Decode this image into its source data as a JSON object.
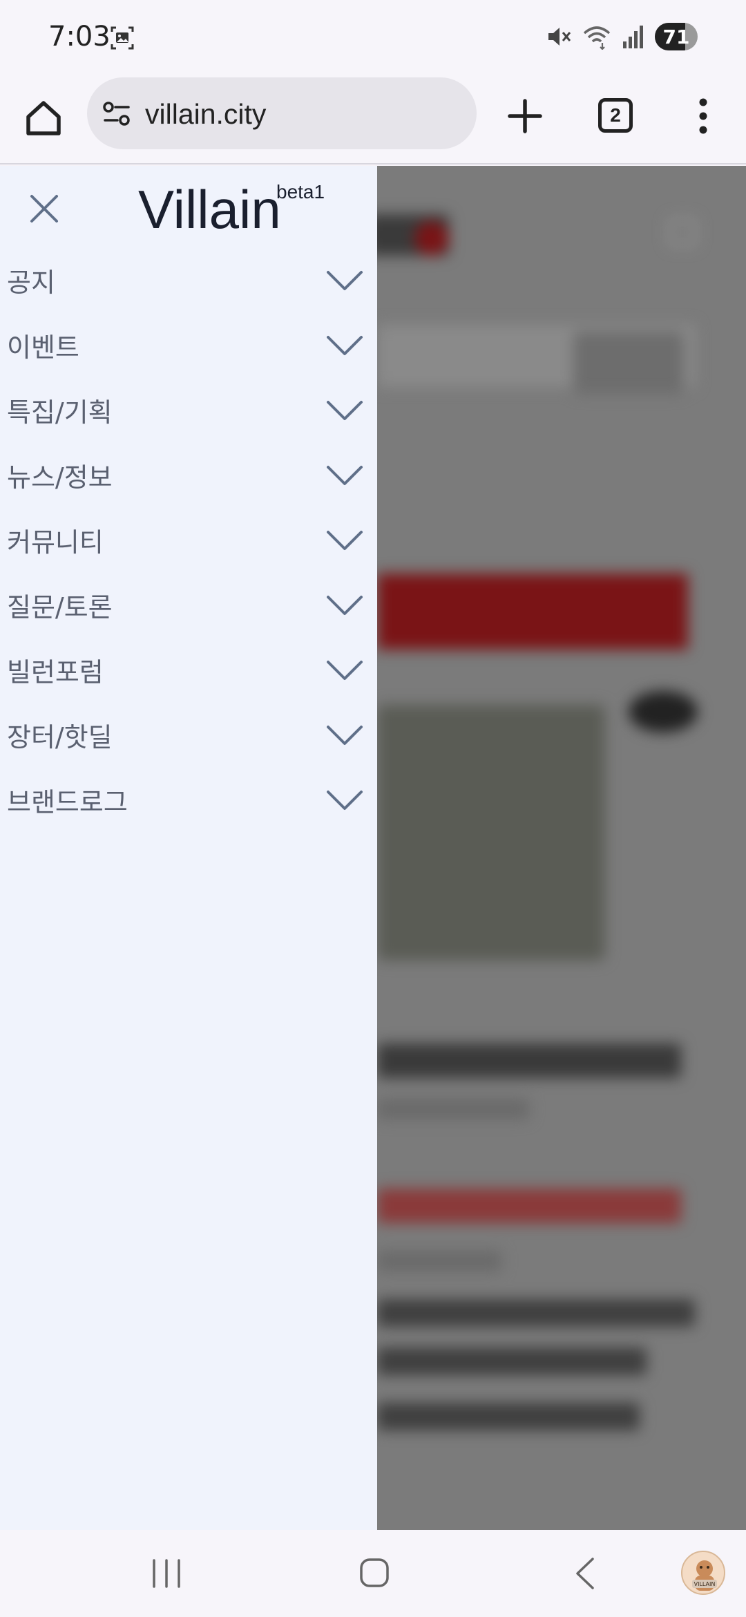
{
  "status_bar": {
    "time": "7:03",
    "battery_level": "71",
    "battery_fraction": 0.71,
    "icons": [
      "screenshot-icon",
      "mute-icon",
      "wifi-icon",
      "signal-icon",
      "battery-icon"
    ]
  },
  "browser": {
    "url": "villain.city",
    "tab_count": "2",
    "icons": [
      "home-icon",
      "site-info-icon",
      "plus-icon",
      "tabs-icon",
      "more-vert-icon"
    ]
  },
  "drawer": {
    "brand": "Villain",
    "brand_superscript": "beta1",
    "items": [
      {
        "label": "공지"
      },
      {
        "label": "이벤트"
      },
      {
        "label": "특집/기획"
      },
      {
        "label": "뉴스/정보"
      },
      {
        "label": "커뮤니티"
      },
      {
        "label": "질문/토론"
      },
      {
        "label": "빌런포럼"
      },
      {
        "label": "장터/핫딜"
      },
      {
        "label": "브랜드로그"
      }
    ]
  },
  "nav_bar": {
    "icons": [
      "recent-apps-icon",
      "home-nav-icon",
      "back-icon"
    ],
    "avatar_label": "VILLAIN"
  },
  "colors": {
    "drawer_bg": "#f0f3fc",
    "overlay": "#7b7b7b",
    "accent_red": "#7a1416"
  }
}
